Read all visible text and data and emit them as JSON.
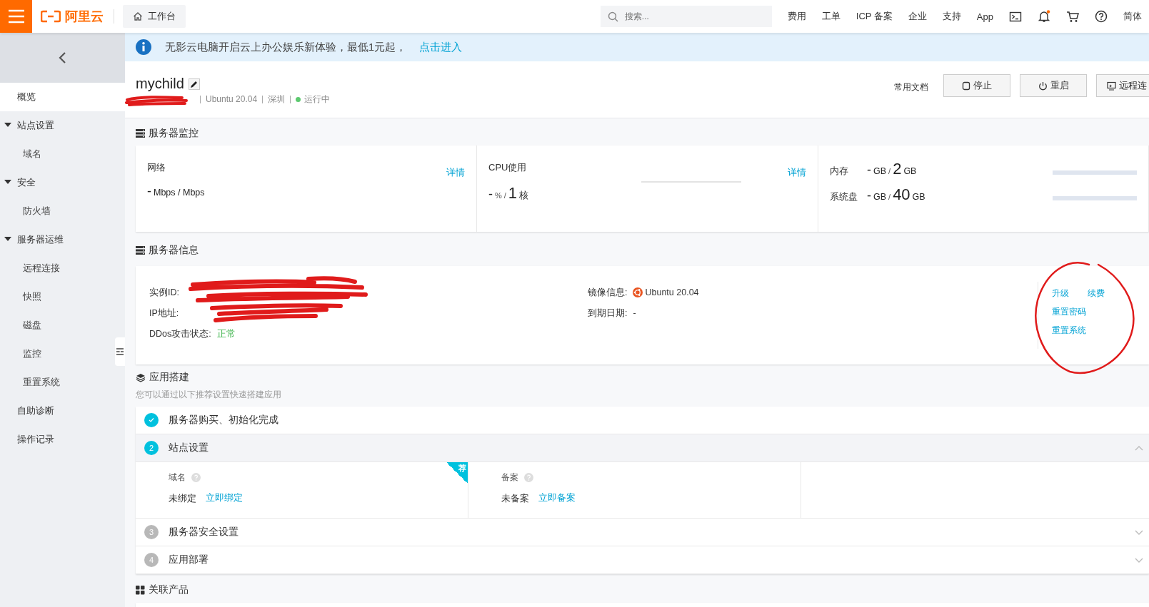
{
  "topbar": {
    "logo": "阿里云",
    "workspace": "工作台",
    "search": {
      "placeholder": "搜索..."
    },
    "nav": [
      {
        "kind": "text",
        "label": "费用"
      },
      {
        "kind": "text",
        "label": "工单"
      },
      {
        "kind": "text",
        "label": "ICP 备案"
      },
      {
        "kind": "text",
        "label": "企业"
      },
      {
        "kind": "text",
        "label": "支持"
      },
      {
        "kind": "text",
        "label": "App"
      },
      {
        "kind": "terminal"
      },
      {
        "kind": "bell",
        "unread": true
      },
      {
        "kind": "cart"
      },
      {
        "kind": "help"
      },
      {
        "kind": "text",
        "label": "简体"
      }
    ]
  },
  "sidebar": {
    "items": [
      {
        "label": "概览",
        "selected": true
      },
      {
        "label": "站点设置",
        "expanded": true,
        "children": [
          {
            "label": "域名",
            "selected": false
          }
        ]
      },
      {
        "label": "安全",
        "expanded": true,
        "children": [
          {
            "label": "防火墙",
            "selected": false
          }
        ]
      },
      {
        "label": "服务器运维",
        "expanded": true,
        "children": [
          {
            "label": "远程连接",
            "selected": false
          },
          {
            "label": "快照",
            "selected": false
          },
          {
            "label": "磁盘",
            "selected": false
          },
          {
            "label": "监控",
            "selected": false
          },
          {
            "label": "重置系统",
            "selected": false
          }
        ]
      },
      {
        "label": "自助诊断",
        "selected": false
      },
      {
        "label": "操作记录",
        "selected": false
      }
    ]
  },
  "banner": {
    "text": "无影云电脑开启云上办公娱乐新体验，最低1元起，",
    "link": "点击进入"
  },
  "instance": {
    "name": "mychild",
    "meta": [
      "Ubuntu 20.04",
      "深圳"
    ],
    "status": "运行中",
    "docs": "常用文档",
    "buttons": [
      {
        "label": "停止",
        "kind": "stop"
      },
      {
        "label": "重启",
        "kind": "power"
      },
      {
        "label": "远程连",
        "kind": "monitor"
      }
    ]
  },
  "monitor": {
    "title": "服务器监控",
    "network": {
      "label": "网络",
      "value": "-",
      "unit": "Mbps / Mbps",
      "link": "详情"
    },
    "cpu": {
      "label": "CPU使用",
      "value": "-",
      "unit": "%",
      "sep": "/",
      "total": "1",
      "total_unit": "核",
      "link": "详情"
    },
    "storage": [
      {
        "label": "内存",
        "value": "-",
        "unit": "GB",
        "sep": "/",
        "total": "2",
        "total_unit": "GB",
        "level": 0
      },
      {
        "label": "系统盘",
        "value": "-",
        "unit": "GB",
        "sep": "/",
        "total": "40",
        "total_unit": "GB",
        "level": 0
      }
    ]
  },
  "info": {
    "title": "服务器信息",
    "fields": [
      {
        "label": "实例ID:"
      },
      {
        "label": "IP地址:"
      },
      {
        "label": "DDos攻击状态:",
        "value": "正常"
      }
    ],
    "image": {
      "label": "镜像信息:",
      "value": "Ubuntu 20.04"
    },
    "expiry": {
      "label": "到期日期:",
      "value": "-"
    },
    "actions": [
      [
        "升级",
        "续费"
      ],
      [
        "重置密码"
      ],
      [
        "重置系统"
      ]
    ]
  },
  "app_setup": {
    "title": "应用搭建",
    "subtitle": "您可以通过以下推荐设置快速搭建应用",
    "steps": [
      {
        "label": "服务器购买、初始化完成",
        "done": true,
        "selected": false,
        "expanded": false
      },
      {
        "number": "2",
        "label": "站点设置",
        "done": false,
        "selected": true,
        "expanded": true,
        "panel": [
          {
            "label": "域名",
            "value": "未绑定",
            "link": "立即绑定",
            "badge": "荐"
          },
          {
            "label": "备案",
            "value": "未备案",
            "link": "立即备案"
          }
        ]
      },
      {
        "number": "3",
        "label": "服务器安全设置",
        "done": false,
        "selected": false,
        "expanded": false
      },
      {
        "number": "4",
        "label": "应用部署",
        "done": false,
        "selected": false,
        "expanded": false
      }
    ]
  },
  "related": {
    "title": "关联产品"
  }
}
